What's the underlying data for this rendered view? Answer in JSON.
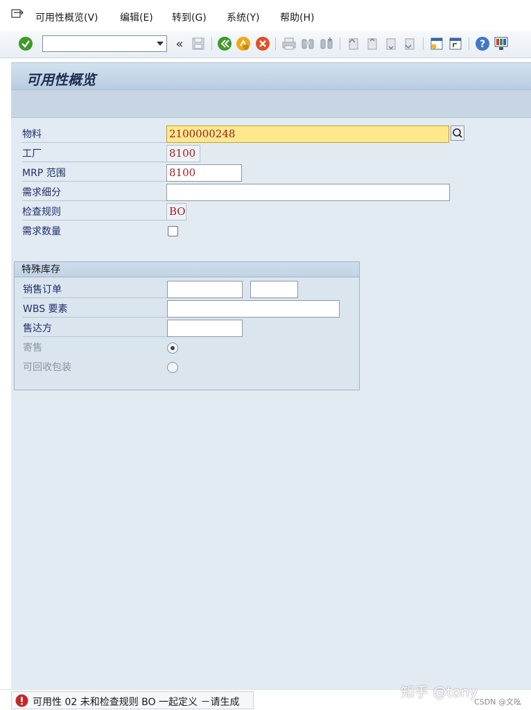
{
  "menubar": {
    "items": [
      {
        "label": "可用性概览(V)"
      },
      {
        "label": "编辑(E)"
      },
      {
        "label": "转到(G)"
      },
      {
        "label": "系统(Y)"
      },
      {
        "label": "帮助(H)"
      }
    ]
  },
  "toolbar": {
    "command_value": "",
    "prev_label": "«"
  },
  "screen": {
    "title": "可用性概览"
  },
  "form": {
    "material": {
      "label": "物料",
      "value": "2100000248"
    },
    "plant": {
      "label": "工厂",
      "value": "8100"
    },
    "mrp_area": {
      "label": "MRP 范围",
      "value": "8100"
    },
    "req_segment": {
      "label": "需求细分",
      "value": ""
    },
    "checking_rule": {
      "label": "检查规则",
      "value": "BO"
    },
    "req_qty": {
      "label": "需求数量",
      "checked": false
    }
  },
  "special_stock": {
    "title": "特殊库存",
    "sales_order": {
      "label": "销售订单",
      "value": "",
      "item_value": ""
    },
    "wbs": {
      "label": "WBS 要素",
      "value": ""
    },
    "sold_to": {
      "label": "售达方",
      "value": ""
    },
    "consignment": {
      "label": "寄售",
      "selected": true
    },
    "returnable": {
      "label": "可回收包装",
      "selected": false
    }
  },
  "status": {
    "message": "可用性 02 未和检查规则 BO 一起定义 －请生成"
  },
  "watermark": {
    "text": "知乎 @tony",
    "csdn": "CSDN @文吆"
  },
  "colors": {
    "accent_green": "#3f9a2c",
    "error_red": "#c62828",
    "field_focus": "#fde88e",
    "value_text": "#a02020"
  }
}
